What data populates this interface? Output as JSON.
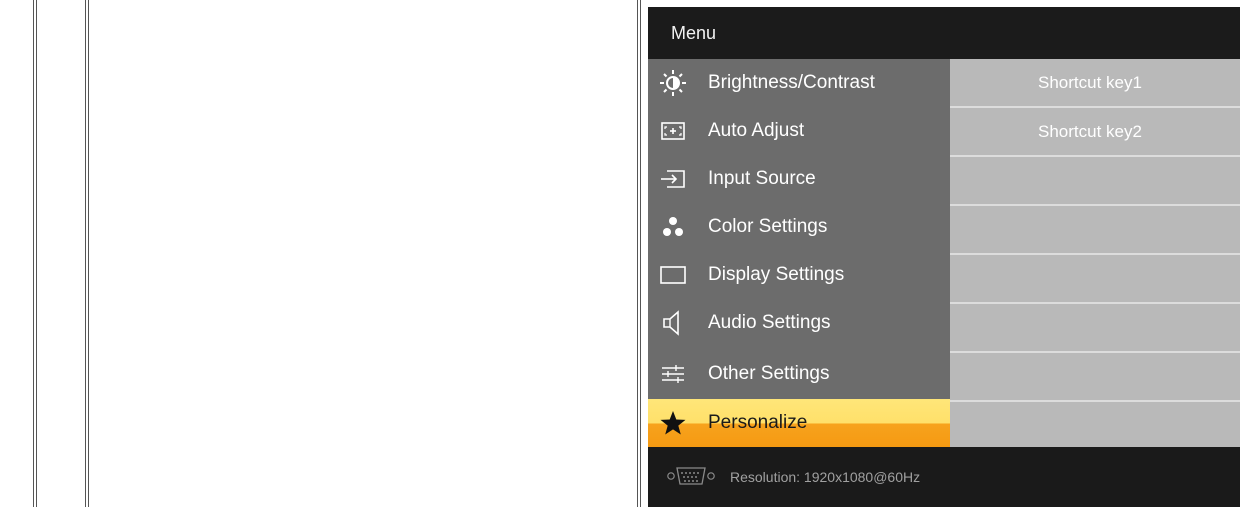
{
  "osd": {
    "title": "Menu",
    "menu_items": [
      {
        "label": "Brightness/Contrast",
        "icon": "brightness-icon"
      },
      {
        "label": "Auto Adjust",
        "icon": "auto-adjust-icon"
      },
      {
        "label": "Input Source",
        "icon": "input-source-icon"
      },
      {
        "label": "Color Settings",
        "icon": "color-settings-icon"
      },
      {
        "label": "Display Settings",
        "icon": "display-settings-icon"
      },
      {
        "label": "Audio Settings",
        "icon": "speaker-icon"
      },
      {
        "label": "Other Settings",
        "icon": "sliders-icon"
      },
      {
        "label": "Personalize",
        "icon": "star-icon",
        "selected": true
      }
    ],
    "submenu": [
      "Shortcut key1",
      "Shortcut key2",
      "",
      "",
      "",
      "",
      "",
      ""
    ],
    "footer": {
      "connector_icon": "vga-connector-icon",
      "resolution": "Resolution:  1920x1080@60Hz"
    },
    "colors": {
      "menu_bg": "#6c6c6c",
      "submenu_bg": "#b9b9b9",
      "selected_top": "#ffe679",
      "selected_bottom": "#f59a12",
      "frame": "#1a1a1a"
    }
  }
}
